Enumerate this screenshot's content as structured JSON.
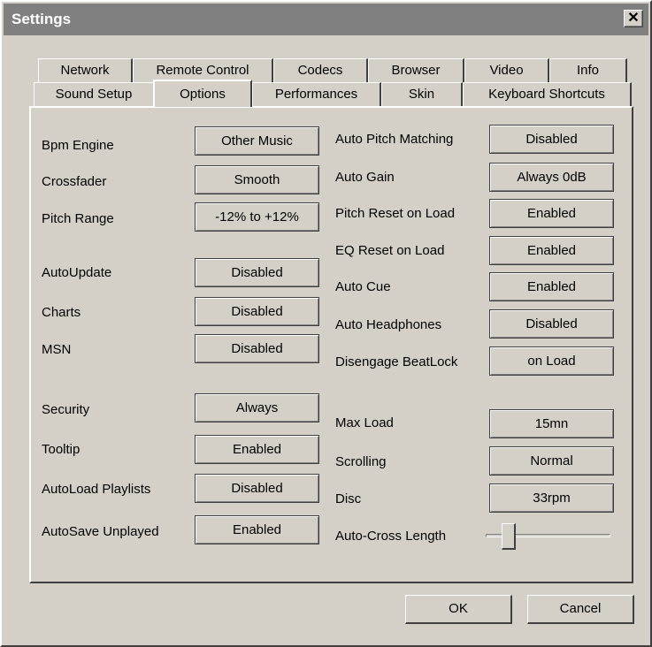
{
  "window": {
    "title": "Settings",
    "close_glyph": "✕"
  },
  "tabs_row1": [
    {
      "label": "Network"
    },
    {
      "label": "Remote Control"
    },
    {
      "label": "Codecs"
    },
    {
      "label": "Browser"
    },
    {
      "label": "Video"
    },
    {
      "label": "Info"
    }
  ],
  "tabs_row2": [
    {
      "label": "Sound Setup"
    },
    {
      "label": "Options",
      "active": true
    },
    {
      "label": "Performances"
    },
    {
      "label": "Skin"
    },
    {
      "label": "Keyboard Shortcuts"
    }
  ],
  "left": {
    "bpm_engine": {
      "label": "Bpm Engine",
      "value": "Other Music"
    },
    "crossfader": {
      "label": "Crossfader",
      "value": "Smooth"
    },
    "pitch_range": {
      "label": "Pitch Range",
      "value": "-12% to +12%"
    },
    "autoupdate": {
      "label": "AutoUpdate",
      "value": "Disabled"
    },
    "charts": {
      "label": "Charts",
      "value": "Disabled"
    },
    "msn": {
      "label": "MSN",
      "value": "Disabled"
    },
    "security": {
      "label": "Security",
      "value": "Always"
    },
    "tooltip": {
      "label": "Tooltip",
      "value": "Enabled"
    },
    "autoload_playlists": {
      "label": "AutoLoad Playlists",
      "value": "Disabled"
    },
    "autosave_unplayed": {
      "label": "AutoSave Unplayed",
      "value": "Enabled"
    }
  },
  "right": {
    "auto_pitch_matching": {
      "label": "Auto Pitch Matching",
      "value": "Disabled"
    },
    "auto_gain": {
      "label": "Auto Gain",
      "value": "Always 0dB"
    },
    "pitch_reset_on_load": {
      "label": "Pitch Reset on Load",
      "value": "Enabled"
    },
    "eq_reset_on_load": {
      "label": "EQ Reset on Load",
      "value": "Enabled"
    },
    "auto_cue": {
      "label": "Auto Cue",
      "value": "Enabled"
    },
    "auto_headphones": {
      "label": "Auto Headphones",
      "value": "Disabled"
    },
    "disengage_beatlock": {
      "label": "Disengage BeatLock",
      "value": "on Load"
    },
    "max_load": {
      "label": "Max Load",
      "value": "15mn"
    },
    "scrolling": {
      "label": "Scrolling",
      "value": "Normal"
    },
    "disc": {
      "label": "Disc",
      "value": "33rpm"
    },
    "auto_cross_length": {
      "label": "Auto-Cross Length",
      "slider_fraction": 0.14
    }
  },
  "buttons": {
    "ok": "OK",
    "cancel": "Cancel"
  }
}
